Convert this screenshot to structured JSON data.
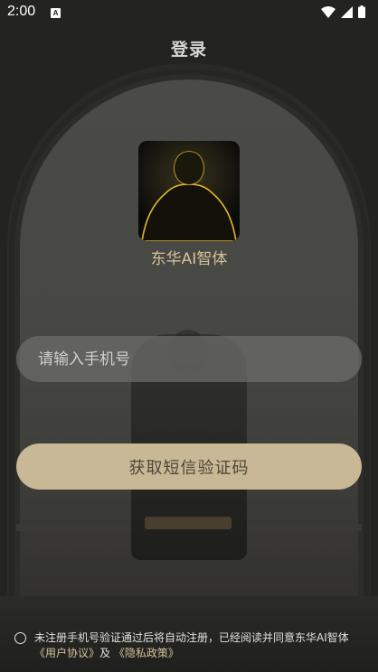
{
  "status_bar": {
    "time": "2:00",
    "notification_icon": "A"
  },
  "header": {
    "title": "登录"
  },
  "app": {
    "name": "东华AI智体"
  },
  "form": {
    "phone_placeholder": "请输入手机号",
    "sms_button_label": "获取短信验证码"
  },
  "agreement": {
    "text": "未注册手机号验证通过后将自动注册，已经阅读并同意东华AI智体",
    "user_agreement_link": "《用户协议》",
    "and": "及",
    "privacy_policy_link": "《隐私政策》"
  },
  "colors": {
    "accent_gold": "#d4c29a",
    "button_bg": "#c9b895",
    "background": "#232321"
  }
}
